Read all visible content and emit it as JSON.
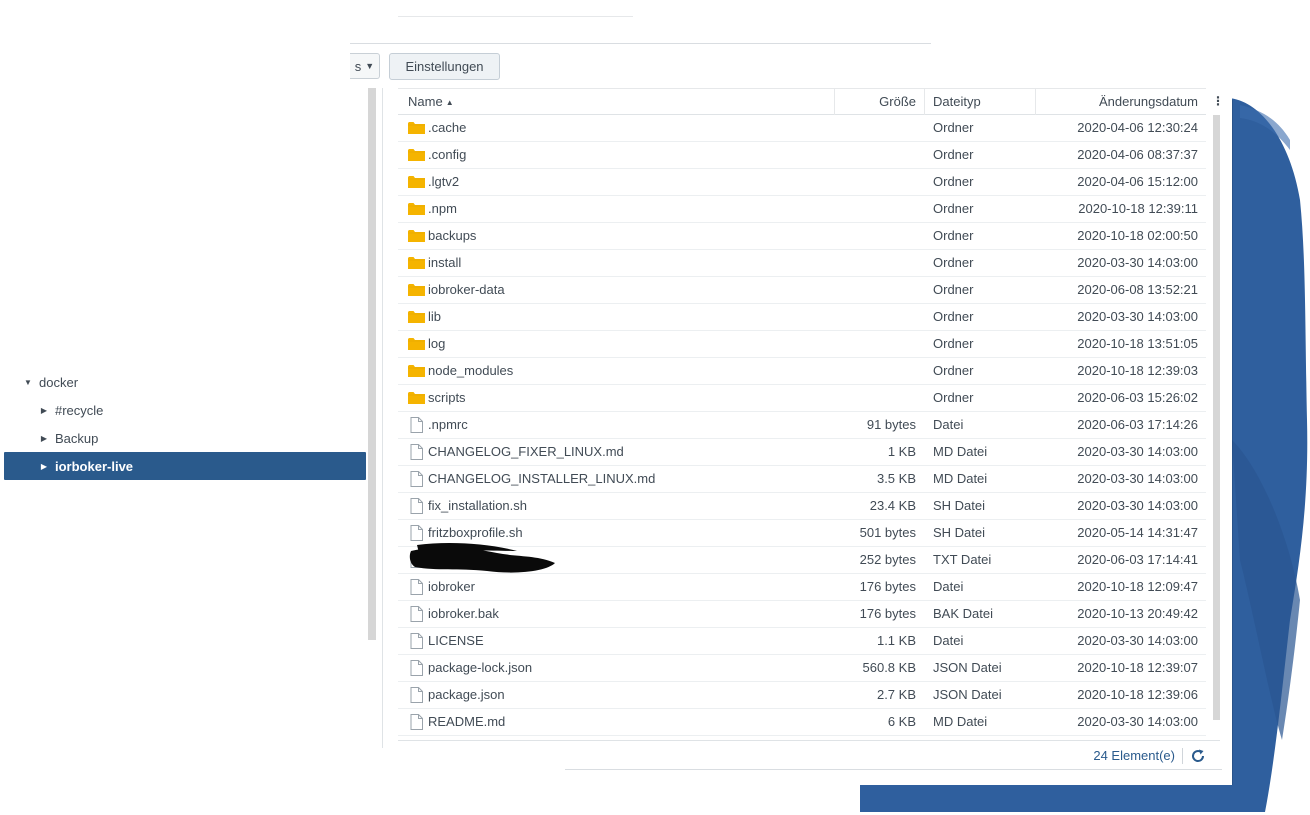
{
  "toolbar": {
    "partial_button_label": "s",
    "settings_button_label": "Einstellungen"
  },
  "tree": {
    "items": [
      {
        "label": "docker",
        "expanded": true,
        "level": 0,
        "selected": false
      },
      {
        "label": "#recycle",
        "expanded": false,
        "level": 1,
        "selected": false
      },
      {
        "label": "Backup",
        "expanded": false,
        "level": 1,
        "selected": false
      },
      {
        "label": "iorboker-live",
        "expanded": false,
        "level": 1,
        "selected": true
      }
    ]
  },
  "columns": {
    "name": "Name",
    "size": "Größe",
    "type": "Dateityp",
    "date": "Änderungsdatum"
  },
  "files": [
    {
      "name": ".cache",
      "size": "",
      "type": "Ordner",
      "date": "2020-04-06 12:30:24",
      "icon": "folder-icon"
    },
    {
      "name": ".config",
      "size": "",
      "type": "Ordner",
      "date": "2020-04-06 08:37:37",
      "icon": "folder-icon"
    },
    {
      "name": ".lgtv2",
      "size": "",
      "type": "Ordner",
      "date": "2020-04-06 15:12:00",
      "icon": "folder-icon"
    },
    {
      "name": ".npm",
      "size": "",
      "type": "Ordner",
      "date": "2020-10-18 12:39:11",
      "icon": "folder-icon"
    },
    {
      "name": "backups",
      "size": "",
      "type": "Ordner",
      "date": "2020-10-18 02:00:50",
      "icon": "folder-icon"
    },
    {
      "name": "install",
      "size": "",
      "type": "Ordner",
      "date": "2020-03-30 14:03:00",
      "icon": "folder-icon"
    },
    {
      "name": "iobroker-data",
      "size": "",
      "type": "Ordner",
      "date": "2020-06-08 13:52:21",
      "icon": "folder-icon"
    },
    {
      "name": "lib",
      "size": "",
      "type": "Ordner",
      "date": "2020-03-30 14:03:00",
      "icon": "folder-icon"
    },
    {
      "name": "log",
      "size": "",
      "type": "Ordner",
      "date": "2020-10-18 13:51:05",
      "icon": "folder-icon"
    },
    {
      "name": "node_modules",
      "size": "",
      "type": "Ordner",
      "date": "2020-10-18 12:39:03",
      "icon": "folder-icon"
    },
    {
      "name": "scripts",
      "size": "",
      "type": "Ordner",
      "date": "2020-06-03 15:26:02",
      "icon": "folder-icon"
    },
    {
      "name": ".npmrc",
      "size": "91 bytes",
      "type": "Datei",
      "date": "2020-06-03 17:14:26",
      "icon": "file-icon"
    },
    {
      "name": "CHANGELOG_FIXER_LINUX.md",
      "size": "1 KB",
      "type": "MD Datei",
      "date": "2020-03-30 14:03:00",
      "icon": "file-icon"
    },
    {
      "name": "CHANGELOG_INSTALLER_LINUX.md",
      "size": "3.5 KB",
      "type": "MD Datei",
      "date": "2020-03-30 14:03:00",
      "icon": "file-icon"
    },
    {
      "name": "fix_installation.sh",
      "size": "23.4 KB",
      "type": "SH Datei",
      "date": "2020-03-30 14:03:00",
      "icon": "file-icon"
    },
    {
      "name": "fritzboxprofile.sh",
      "size": "501 bytes",
      "type": "SH Datei",
      "date": "2020-05-14 14:31:47",
      "icon": "file-icon"
    },
    {
      "name": "",
      "size": "252 bytes",
      "type": "TXT Datei",
      "date": "2020-06-03 17:14:41",
      "icon": "file-icon",
      "redacted": true
    },
    {
      "name": "iobroker",
      "size": "176 bytes",
      "type": "Datei",
      "date": "2020-10-18 12:09:47",
      "icon": "file-icon"
    },
    {
      "name": "iobroker.bak",
      "size": "176 bytes",
      "type": "BAK Datei",
      "date": "2020-10-13 20:49:42",
      "icon": "file-icon"
    },
    {
      "name": "LICENSE",
      "size": "1.1 KB",
      "type": "Datei",
      "date": "2020-03-30 14:03:00",
      "icon": "file-icon"
    },
    {
      "name": "package-lock.json",
      "size": "560.8 KB",
      "type": "JSON Datei",
      "date": "2020-10-18 12:39:07",
      "icon": "file-icon"
    },
    {
      "name": "package.json",
      "size": "2.7 KB",
      "type": "JSON Datei",
      "date": "2020-10-18 12:39:06",
      "icon": "file-icon"
    },
    {
      "name": "README.md",
      "size": "6 KB",
      "type": "MD Datei",
      "date": "2020-03-30 14:03:00",
      "icon": "file-icon"
    }
  ],
  "footer": {
    "count_text": "24 Element(e)"
  },
  "colors": {
    "accent": "#2a5a8c",
    "folder": "#f5b400",
    "background_blob": "#2f5f9e"
  }
}
